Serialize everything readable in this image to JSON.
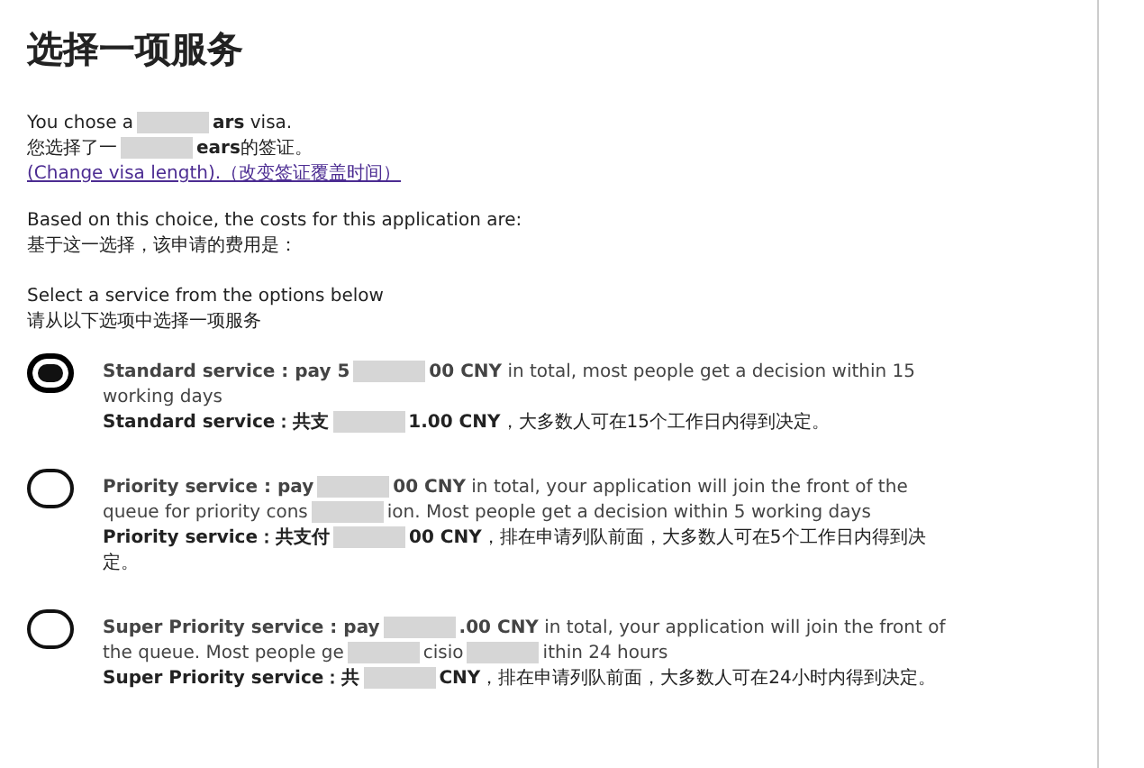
{
  "title": "选择一项服务",
  "choice": [
    [
      {
        "kind": "text",
        "text": "You chose a"
      },
      {
        "kind": "redacted"
      },
      {
        "kind": "text",
        "text": "**ars** visa."
      }
    ],
    [
      {
        "kind": "text",
        "text": "您选择了一"
      },
      {
        "kind": "redacted"
      },
      {
        "kind": "text",
        "text": "**ears**的签证。"
      }
    ]
  ],
  "change_link": "(Change visa length).（改变签证覆盖时间）",
  "costs": [
    "Based on this choice, the costs for this application are:",
    "基于这一选择，该申请的费用是："
  ],
  "select_prompt": [
    "Select a service from the options below",
    "请从以下选项中选择一项服务"
  ],
  "options": [
    {
      "selected": true,
      "en": [
        {
          "kind": "text",
          "text": "**Standard service : pay 5**"
        },
        {
          "kind": "redacted"
        },
        {
          "kind": "text",
          "text": "**00 CNY** in total, most people get a decision within 15 working days"
        }
      ],
      "zh": [
        {
          "kind": "text",
          "text": "**Standard service：共支**"
        },
        {
          "kind": "redacted"
        },
        {
          "kind": "text",
          "text": "**1.00 CNY**，大多数人可在15个工作日内得到决定。"
        }
      ]
    },
    {
      "selected": false,
      "en": [
        {
          "kind": "text",
          "text": "**Priority service : pay**"
        },
        {
          "kind": "redacted"
        },
        {
          "kind": "text",
          "text": "**00 CNY** in total, your application will join the front of the queue for priority cons"
        },
        {
          "kind": "redacted"
        },
        {
          "kind": "text",
          "text": "ion. Most people get a decision within 5 working days"
        }
      ],
      "zh": [
        {
          "kind": "text",
          "text": "**Priority service：共支付**"
        },
        {
          "kind": "redacted"
        },
        {
          "kind": "text",
          "text": "**00 CNY**，排在申请列队前面，大多数人可在5个工作日内得到决定。"
        }
      ]
    },
    {
      "selected": false,
      "en": [
        {
          "kind": "text",
          "text": "**Super Priority service : pay**"
        },
        {
          "kind": "redacted"
        },
        {
          "kind": "text",
          "text": "**.00 CNY** in total, your application will join the front of the queue. Most people ge"
        },
        {
          "kind": "redacted"
        },
        {
          "kind": "text",
          "text": "cisio"
        },
        {
          "kind": "redacted"
        },
        {
          "kind": "text",
          "text": "ithin 24 hours"
        }
      ],
      "zh": [
        {
          "kind": "text",
          "text": "**Super Priority service：共**"
        },
        {
          "kind": "redacted"
        },
        {
          "kind": "text",
          "text": "**CNY**，排在申请列队前面，大多数人可在24小时内得到决定。"
        }
      ]
    }
  ]
}
